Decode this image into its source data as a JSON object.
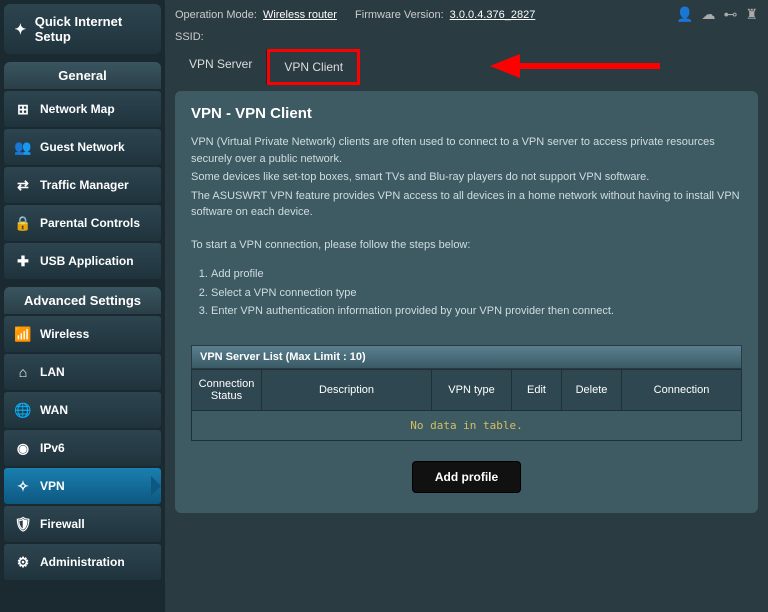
{
  "qis_label": "Quick Internet Setup",
  "section1": "General",
  "section2": "Advanced Settings",
  "nav_general": [
    {
      "label": "Network Map"
    },
    {
      "label": "Guest Network"
    },
    {
      "label": "Traffic Manager"
    },
    {
      "label": "Parental Controls"
    },
    {
      "label": "USB Application"
    }
  ],
  "nav_advanced": [
    {
      "label": "Wireless"
    },
    {
      "label": "LAN"
    },
    {
      "label": "WAN"
    },
    {
      "label": "IPv6"
    },
    {
      "label": "VPN"
    },
    {
      "label": "Firewall"
    },
    {
      "label": "Administration"
    }
  ],
  "topbar": {
    "op_mode_lbl": "Operation Mode:",
    "op_mode_val": "Wireless router",
    "fw_lbl": "Firmware Version:",
    "fw_val": "3.0.0.4.376_2827",
    "ssid_lbl": "SSID:"
  },
  "tabs": {
    "server": "VPN Server",
    "client": "VPN Client"
  },
  "page": {
    "title": "VPN - VPN Client",
    "p1": "VPN (Virtual Private Network) clients are often used to connect to a VPN server to access private resources securely over a public network.",
    "p2": "Some devices like set-top boxes, smart TVs and Blu-ray players do not support VPN software.",
    "p3": "The ASUSWRT VPN feature provides VPN access to all devices in a home network without having to install VPN software on each device.",
    "intro": "To start a VPN connection, please follow the steps below:",
    "s1": "Add profile",
    "s2": "Select a VPN connection type",
    "s3": "Enter VPN authentication information provided by your VPN provider then connect."
  },
  "table": {
    "title": "VPN Server List (Max Limit : 10)",
    "h1": "Connection Status",
    "h2": "Description",
    "h3": "VPN type",
    "h4": "Edit",
    "h5": "Delete",
    "h6": "Connection",
    "empty": "No data in table."
  },
  "add_btn": "Add profile"
}
